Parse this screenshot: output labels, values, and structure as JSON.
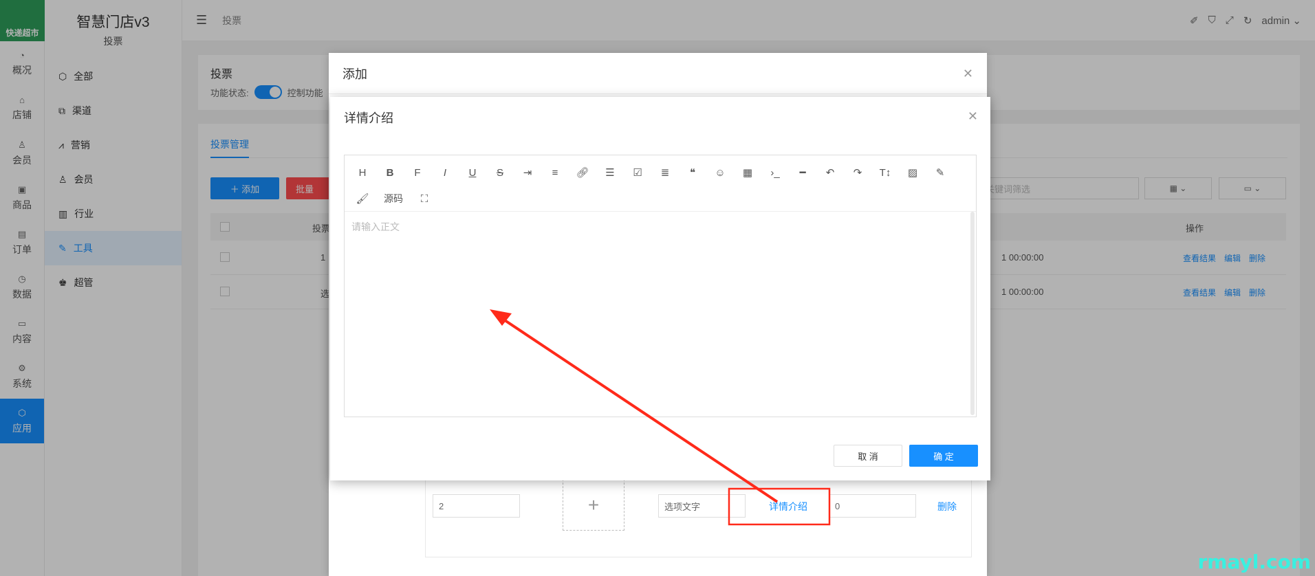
{
  "rail": {
    "logo_text": "快递超市",
    "items": [
      {
        "icon": "dashboard-icon",
        "label": "概况"
      },
      {
        "icon": "store-icon",
        "label": "店铺"
      },
      {
        "icon": "user-icon",
        "label": "会员"
      },
      {
        "icon": "box-icon",
        "label": "商品"
      },
      {
        "icon": "clipboard-icon",
        "label": "订单"
      },
      {
        "icon": "pie-icon",
        "label": "数据"
      },
      {
        "icon": "folder-icon",
        "label": "内容"
      },
      {
        "icon": "gear-icon",
        "label": "系统"
      },
      {
        "icon": "cube-icon",
        "label": "应用"
      }
    ]
  },
  "brand": {
    "title": "智慧门店v3",
    "subtitle": "投票"
  },
  "side": {
    "items": [
      {
        "icon": "cube-icon",
        "label": "全部"
      },
      {
        "icon": "channel-icon",
        "label": "渠道"
      },
      {
        "icon": "chart-icon",
        "label": "营销"
      },
      {
        "icon": "user-icon",
        "label": "会员"
      },
      {
        "icon": "briefcase-icon",
        "label": "行业"
      },
      {
        "icon": "wrench-icon",
        "label": "工具"
      },
      {
        "icon": "admin-icon",
        "label": "超管"
      }
    ]
  },
  "header": {
    "breadcrumb": "投票",
    "user": "admin"
  },
  "page": {
    "title": "投票",
    "status_label": "功能状态:",
    "status_desc": "控制功能",
    "tab": "投票管理",
    "add_label": "＋ 添加",
    "batch_del_label": "批量",
    "keyword_placeholder": "关键词筛选",
    "col_vote": "投票",
    "col_ops": "操作",
    "rows": [
      {
        "c1": "1",
        "time": "1 00:00:00",
        "ops": [
          "查看结果",
          "编辑",
          "删除"
        ]
      },
      {
        "c1": "选",
        "time": "1 00:00:00",
        "ops": [
          "查看结果",
          "编辑",
          "删除"
        ]
      }
    ]
  },
  "modal_add": {
    "title": "添加",
    "row": {
      "order": "2",
      "option_text": "选项文字",
      "detail": "详情介绍",
      "count": "0",
      "delete": "删除"
    }
  },
  "modal_detail": {
    "title": "详情介绍",
    "placeholder": "请输入正文",
    "source_label": "源码",
    "cancel": "取 消",
    "confirm": "确 定"
  },
  "watermark": "rmayl.com",
  "colors": {
    "primary": "#1890ff",
    "danger": "#ff4d4f",
    "annotation": "#ff2a1a",
    "logo": "#2e9e5b"
  }
}
